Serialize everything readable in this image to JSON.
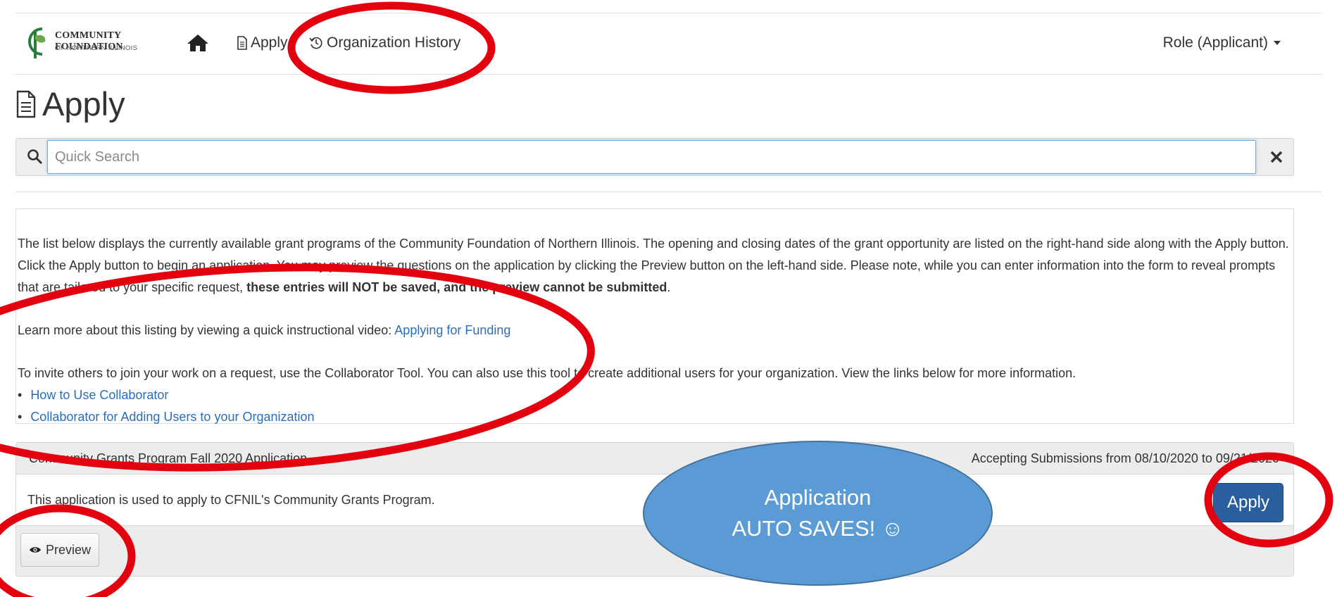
{
  "brand": {
    "name": "COMMUNITY FOUNDATION",
    "sub": "OF NORTHERN ILLINOIS"
  },
  "nav": {
    "apply": "Apply",
    "history": "Organization History",
    "role": "Role (Applicant)"
  },
  "page": {
    "title": "Apply"
  },
  "search": {
    "placeholder": "Quick Search"
  },
  "info": {
    "p1_text": "The list below displays the currently available grant programs of the Community Foundation of Northern Illinois. The opening and closing dates of the grant opportunity are listed on the right-hand side along with the Apply button. Click the Apply button to begin an application. You may preview the questions on the application by clicking the Preview button on the left-hand side. Please note, while you can enter information into the form to reveal prompts that are tailored to your specific request, ",
    "p1_bold": "these entries will NOT be saved, and the preview cannot be submitted",
    "p1_end": ".",
    "p2_text": "Learn more about this listing by viewing a quick instructional video: ",
    "p2_link": "Applying for Funding",
    "p3_text": "To invite others to join your work on a request, use the Collaborator Tool. You can also use this tool to create additional users for your organization. View the links below for more information.",
    "links": [
      "How to Use Collaborator",
      "Collaborator for Adding Users to your Organization"
    ]
  },
  "grant": {
    "title": "Community Grants Program Fall 2020 Application",
    "dates": "Accepting Submissions from 08/10/2020 to 09/21/2020",
    "description": "This application is used to apply to CFNIL's Community Grants Program.",
    "apply_label": "Apply",
    "preview_label": "Preview"
  },
  "callout": {
    "line1": "Application",
    "line2": "AUTO SAVES! ☺"
  },
  "colors": {
    "link": "#2a6ebb",
    "apply_button": "#2a5f9d",
    "callout_fill": "#5b9bd5",
    "annotation_red": "#e3000f"
  }
}
